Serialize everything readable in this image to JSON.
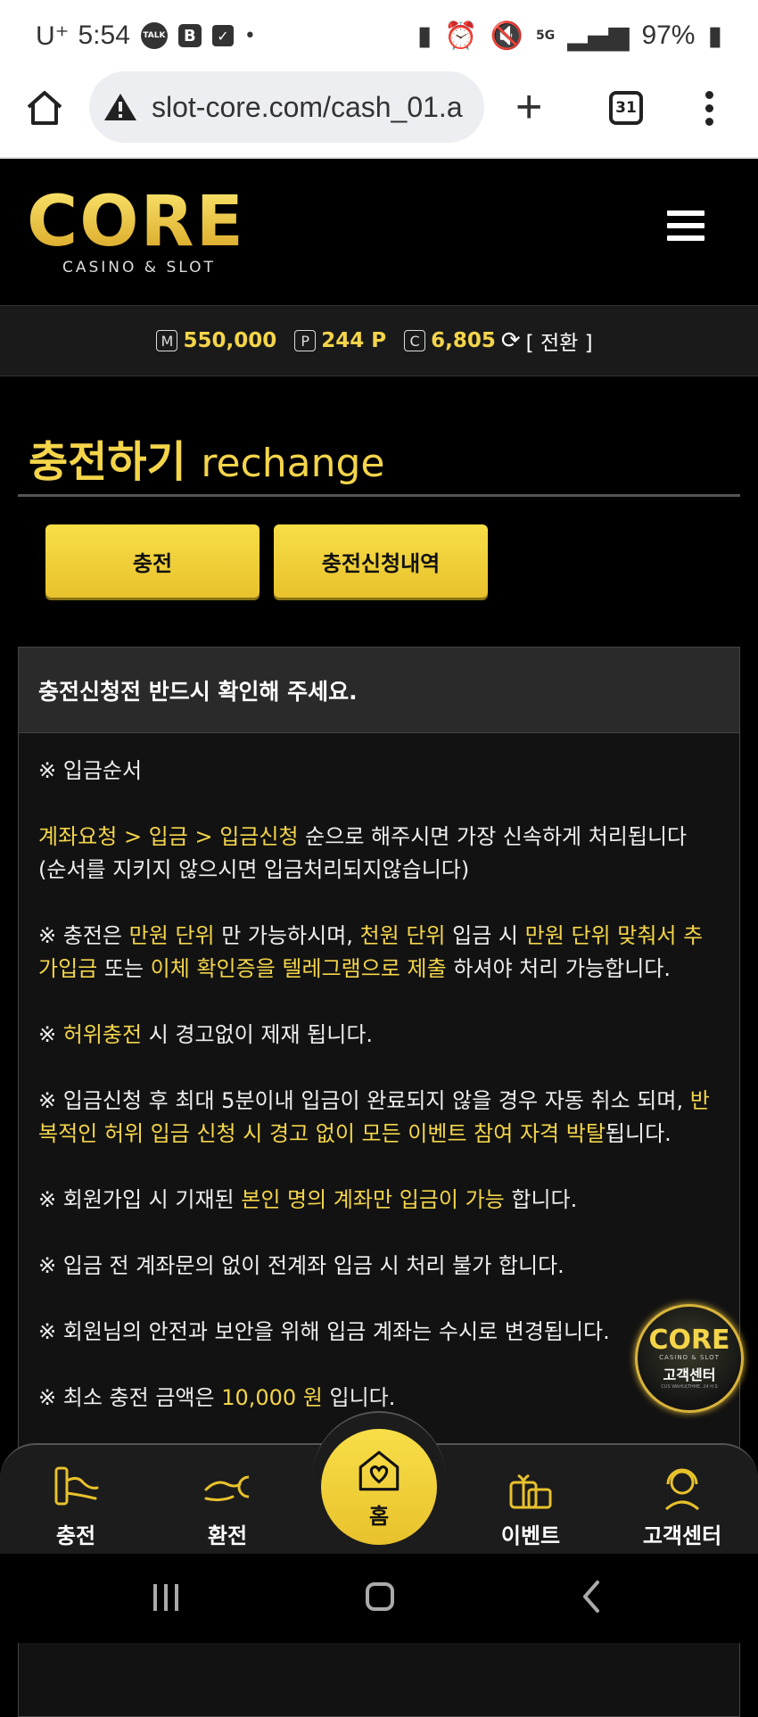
{
  "status": {
    "carrier": "U⁺",
    "time": "5:54",
    "talk": "TALK",
    "b_icon": "B",
    "net": "5G",
    "battery": "97%"
  },
  "browser": {
    "url": "slot-core.com/cash_01.a",
    "tab_count": "31"
  },
  "logo": {
    "name": "CORE",
    "tagline": "CASINO & SLOT"
  },
  "balance": {
    "money_icon": "M",
    "money": "550,000",
    "point_icon": "P",
    "point": "244 P",
    "coin_icon": "C",
    "coin": "6,805",
    "convert": "[ 전환 ]"
  },
  "title": {
    "ko": "충전하기",
    "en": "rechange"
  },
  "tabs": {
    "charge": "충전",
    "history": "충전신청내역"
  },
  "notice": {
    "header": "충전신청전 반드시 확인해 주세요.",
    "l1": "※ 입금순서",
    "l2a": "계좌요청 > 입금 > 입금신청",
    "l2b": " 순으로 해주시면 가장 신속하게 처리됩니다 (순서를 지키지 않으시면 입금처리되지않습니다)",
    "l3a": "※ 충전은 ",
    "l3b": "만원 단위",
    "l3c": " 만 가능하시며, ",
    "l3d": "천원 단위",
    "l3e": " 입금 시 ",
    "l3f": "만원 단위 맞춰서 추가입금",
    "l3g": " 또는 ",
    "l3h": "이체 확인증을 텔레그램으로 제출",
    "l3i": " 하셔야 처리 가능합니다.",
    "l4a": "※ ",
    "l4b": "허위충전",
    "l4c": " 시 경고없이 제재 됩니다.",
    "l5a": "※ 입금신청 후 최대 5분이내 입금이 완료되지 않을 경우 자동 취소 되며, ",
    "l5b": "반복적인 허위 입금 신청 시 경고 없이 모든 이벤트 참여 자격 박탈",
    "l5c": "됩니다.",
    "l6a": "※ 회원가입 시 기재된 ",
    "l6b": "본인 명의 계좌만 입금이 가능",
    "l6c": " 합니다.",
    "l7": "※ 입금 전 계좌문의 없이 전계좌 입금 시 처리 불가 합니다.",
    "l8": "※ 회원님의 안전과 보안을 위해 입금 계좌는 수시로 변경됩니다.",
    "l9a": "※ 최소 충전 금액은 ",
    "l9b": "10,000 원",
    "l9c": " 입니다."
  },
  "float_support": {
    "logo": "CORE",
    "sub": "CASINO & SLOT",
    "label": "고객센터",
    "small": "CUS WAHULTHME, 24 H.S"
  },
  "bottom_nav": {
    "charge": "충전",
    "exchange": "환전",
    "home": "홈",
    "event": "이벤트",
    "support": "고객센터"
  },
  "colors": {
    "accent": "#f4d54a",
    "background": "#000000",
    "panel": "#121212"
  }
}
